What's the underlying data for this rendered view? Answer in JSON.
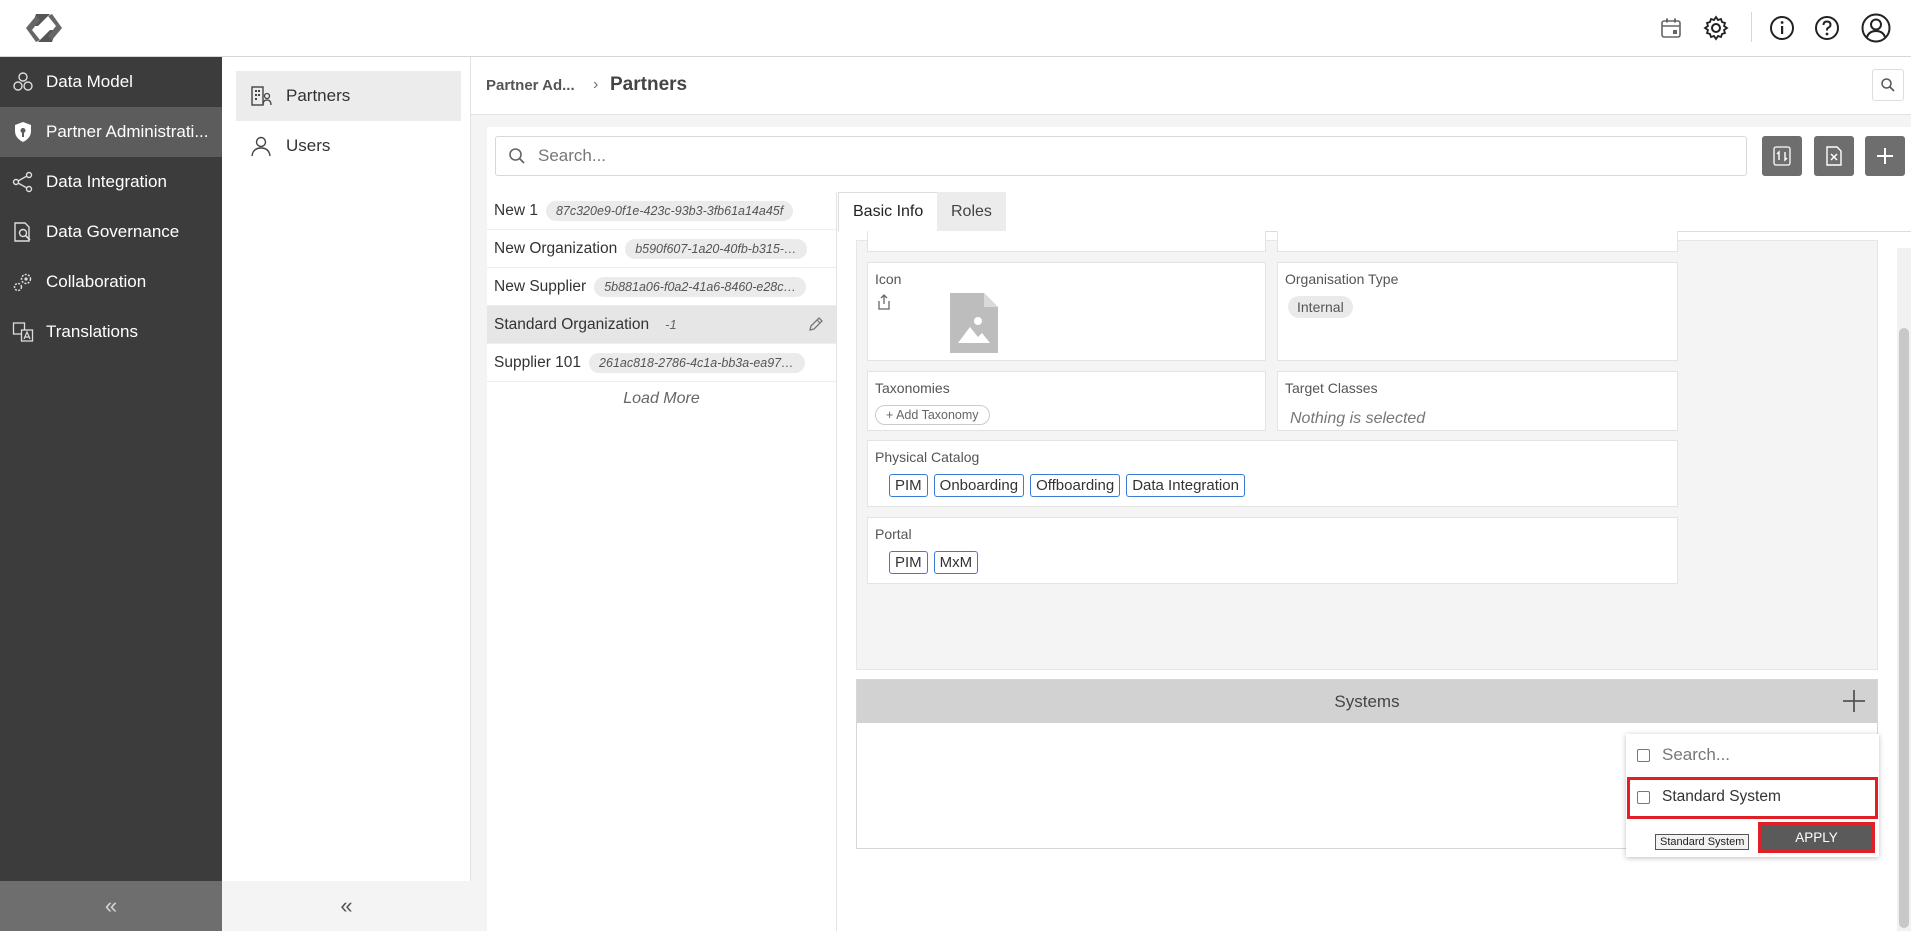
{
  "topbar": {
    "icons": [
      "calendar-box-icon",
      "gear-icon",
      "info-icon",
      "help-icon",
      "user-avatar-icon"
    ]
  },
  "sidebar": {
    "items": [
      {
        "label": "Data Model",
        "icon": "cubes-icon"
      },
      {
        "label": "Partner Administrati...",
        "icon": "shield-icon",
        "active": true
      },
      {
        "label": "Data Integration",
        "icon": "share-nodes-icon"
      },
      {
        "label": "Data Governance",
        "icon": "document-search-icon"
      },
      {
        "label": "Collaboration",
        "icon": "gears-icon"
      },
      {
        "label": "Translations",
        "icon": "translate-icon"
      }
    ],
    "collapse_label": "«"
  },
  "subnav": {
    "items": [
      {
        "label": "Partners",
        "icon": "partners-building-icon",
        "active": true
      },
      {
        "label": "Users",
        "icon": "user-icon"
      }
    ],
    "collapse_label": "«"
  },
  "header": {
    "breadcrumb_parent": "Partner Ad...",
    "breadcrumb_separator": "›",
    "breadcrumb_current": "Partners"
  },
  "search": {
    "placeholder": "Search..."
  },
  "partners": [
    {
      "name": "New 1",
      "id": "87c320e9-0f1e-423c-93b3-3fb61a14a45f"
    },
    {
      "name": "New Organization",
      "id": "b590f607-1a20-40fb-b315-7..."
    },
    {
      "name": "New Supplier",
      "id": "5b881a06-f0a2-41a6-8460-e28c7a..."
    },
    {
      "name": "Standard Organization",
      "id": "-1",
      "selected": true
    },
    {
      "name": "Supplier 101",
      "id": "261ac818-2786-4c1a-bb3a-ea9763..."
    }
  ],
  "load_more": "Load More",
  "tabs": [
    {
      "label": "Basic Info",
      "active": true
    },
    {
      "label": "Roles",
      "active": false
    }
  ],
  "fields": {
    "icon_label": "Icon",
    "org_type_label": "Organisation Type",
    "org_type_value": "Internal",
    "taxonomies_label": "Taxonomies",
    "add_taxonomy": "+ Add Taxonomy",
    "target_classes_label": "Target Classes",
    "target_classes_value": "Nothing is selected",
    "physical_catalog_label": "Physical Catalog",
    "physical_catalog": [
      "PIM",
      "Onboarding",
      "Offboarding",
      "Data Integration"
    ],
    "portal_label": "Portal",
    "portal": [
      "PIM",
      "MxM"
    ]
  },
  "systems": {
    "title": "Systems",
    "dropdown": {
      "search_placeholder": "Search...",
      "option": "Standard System",
      "tooltip": "Standard System",
      "apply": "APPLY"
    }
  },
  "colors": {
    "sidebar_bg": "#3c3c3c",
    "sidebar_active": "#5c5c5c",
    "pill_border": "#3a7bd5",
    "highlight": "#e01f26"
  }
}
